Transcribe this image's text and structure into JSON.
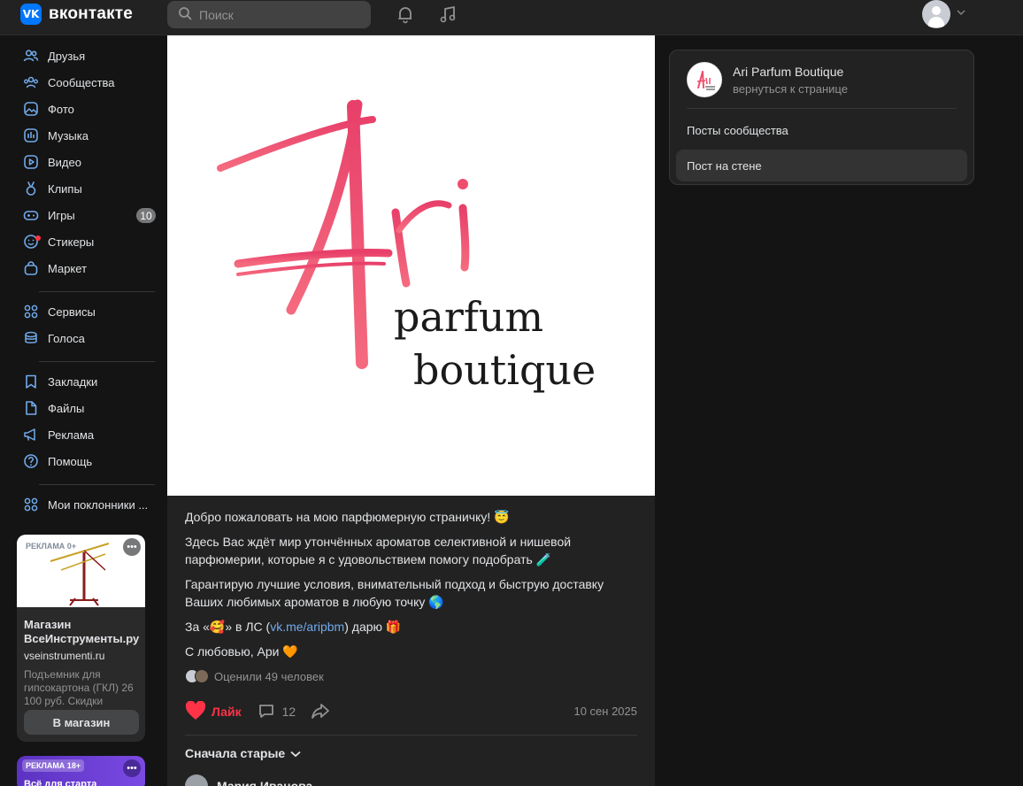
{
  "header": {
    "logo_mark": "VK",
    "logo_text": "вконтакте",
    "search_placeholder": "Поиск",
    "icons": [
      "bell-icon",
      "music-note-icon",
      "avatar",
      "chevron-down-icon"
    ]
  },
  "sidebar": {
    "items": [
      {
        "label": "Друзья",
        "icon": "friends-icon"
      },
      {
        "label": "Сообщества",
        "icon": "communities-icon"
      },
      {
        "label": "Фото",
        "icon": "photo-icon"
      },
      {
        "label": "Музыка",
        "icon": "music-icon"
      },
      {
        "label": "Видео",
        "icon": "video-icon"
      },
      {
        "label": "Клипы",
        "icon": "clips-icon"
      },
      {
        "label": "Игры",
        "icon": "games-icon",
        "badge": "10"
      },
      {
        "label": "Стикеры",
        "icon": "stickers-icon"
      },
      {
        "label": "Маркет",
        "icon": "market-icon"
      }
    ],
    "items2": [
      {
        "label": "Сервисы",
        "icon": "services-icon"
      },
      {
        "label": "Голоса",
        "icon": "votes-icon"
      }
    ],
    "items3": [
      {
        "label": "Закладки",
        "icon": "bookmark-icon"
      },
      {
        "label": "Файлы",
        "icon": "files-icon"
      },
      {
        "label": "Реклама",
        "icon": "ads-icon"
      },
      {
        "label": "Помощь",
        "icon": "help-icon"
      }
    ],
    "items4": [
      {
        "label": "Мои поклонники ...",
        "icon": "fans-icon"
      }
    ]
  },
  "ad": {
    "label": "РЕКЛАМА  0+",
    "title": "Магазин ВсеИнструменты.ру",
    "domain": "vseinstrumenti.ru",
    "description": "Подъемник для гипсокартона (ГКЛ) 26 100 руб. Скидки",
    "button": "В магазин",
    "label2": "РЕКЛАМА  18+",
    "title2": "Всё для старта"
  },
  "post": {
    "image_text": {
      "big": "Ari",
      "line1": "parfum",
      "line2": "boutique"
    },
    "paragraphs": {
      "p1": "Добро пожаловать на мою парфюмерную страничку! 😇",
      "p2": "Здесь Вас ждёт мир утончённых ароматов селективной и нишевой парфюмерии, которые я с удовольствием помогу подобрать 🧪",
      "p3": "Гарантирую лучшие условия, внимательный подход и быструю доставку Ваших любимых ароматов в любую точку 🌎",
      "p4_before": "За «🥰» в ЛС (",
      "p4_link": "vk.me/aripbm",
      "p4_after": ") дарю 🎁",
      "p5": "С любовью, Ари 🧡"
    },
    "rated": "Оценили 49 человек",
    "like_label": "Лайк",
    "comments_count": "12",
    "date": "10 сен 2025",
    "sort_label": "Сначала старые",
    "first_commenter": "Мария Иванова"
  },
  "panel": {
    "name": "Ari Parfum Boutique",
    "back": "вернуться к странице",
    "items": [
      "Посты сообщества",
      "Пост на стене"
    ]
  },
  "colors": {
    "accent": "#0077ff",
    "like": "#ff3347",
    "link": "#71aaeb",
    "logo_pink": "#f0506e"
  }
}
